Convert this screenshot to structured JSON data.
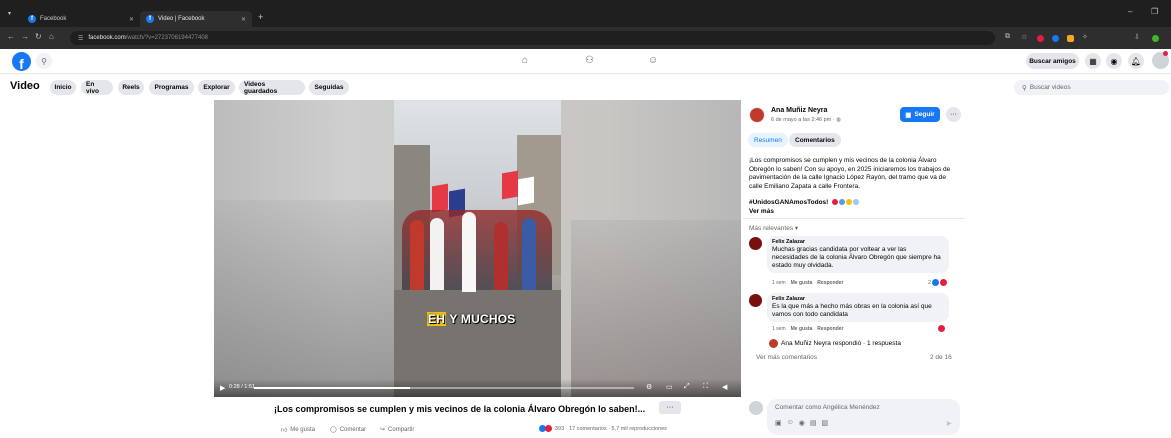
{
  "browser": {
    "tabs": [
      {
        "label": "Facebook"
      },
      {
        "label": "Video | Facebook"
      }
    ],
    "url_domain": "facebook.com",
    "url_path": "/watch/?v=2723706194477408"
  },
  "header": {
    "logo": "f",
    "buscar_amigos": "Buscar amigos"
  },
  "subnav": {
    "title": "Video",
    "pills": [
      "Inicio",
      "En vivo",
      "Reels",
      "Programas",
      "Explorar",
      "Videos guardados",
      "Seguidas"
    ],
    "search_placeholder": "Buscar videos"
  },
  "player": {
    "caption_highlight": "EH",
    "caption_rest": "Y MUCHOS",
    "time": "0:28 / 1:51",
    "progress": 0.41
  },
  "video": {
    "title": "¡Los compromisos se cumplen y mis vecinos de la colonia Álvaro Obregón lo saben!...",
    "more": "···",
    "like": "Me gusta",
    "comment": "Comentar",
    "share": "Compartir",
    "stats": "393 · 17 comentarios · 5,7 mil reproducciones"
  },
  "panel": {
    "author": "Ana Muñiz Neyra",
    "date": "6 de mayo a las 2:46 pm · ",
    "follow": "Seguir",
    "more": "···",
    "tab_summary": "Resumen",
    "tab_comments": "Comentarios",
    "description": "¡Los compromisos se cumplen y mis vecinos de la colonia Álvaro Obregón lo saben! Con su apoyo, en 2025 iniciaremos los trabajos de pavimentación de la calle Ignacio López Rayón, del tramo que va de calle Emiliano Zapata a calle Frontera.",
    "hashtag": "#UnidosGANAmosTodos!",
    "see_more": "Ver más",
    "relevant": "Más relevantes ▾",
    "comments": [
      {
        "name": "Felix Zalazar",
        "text": "Muchas gracias candidata por voltear a ver las necesidades de la colonia Álvaro Obregón que siempre ha estado muy olvidada.",
        "time": "1 sem",
        "like": "Me gusta",
        "reply": "Responder",
        "reactions": "2"
      },
      {
        "name": "Felix Zalazar",
        "text": "Es la que más a hecho más obras en la colonia así que vamos con todo candidata",
        "time": "1 sem",
        "like": "Me gusta",
        "reply": "Responder",
        "reactions": ""
      }
    ],
    "replied": "Ana Muñiz Neyra respondió · 1 respuesta",
    "more_comments": "Ver más comentarios",
    "count": "2 de 16",
    "comment_placeholder": "Comentar como Angélica Menéndez"
  },
  "colors": {
    "fb_blue": "#1877f2",
    "reaction_red": "#e41e3f"
  }
}
